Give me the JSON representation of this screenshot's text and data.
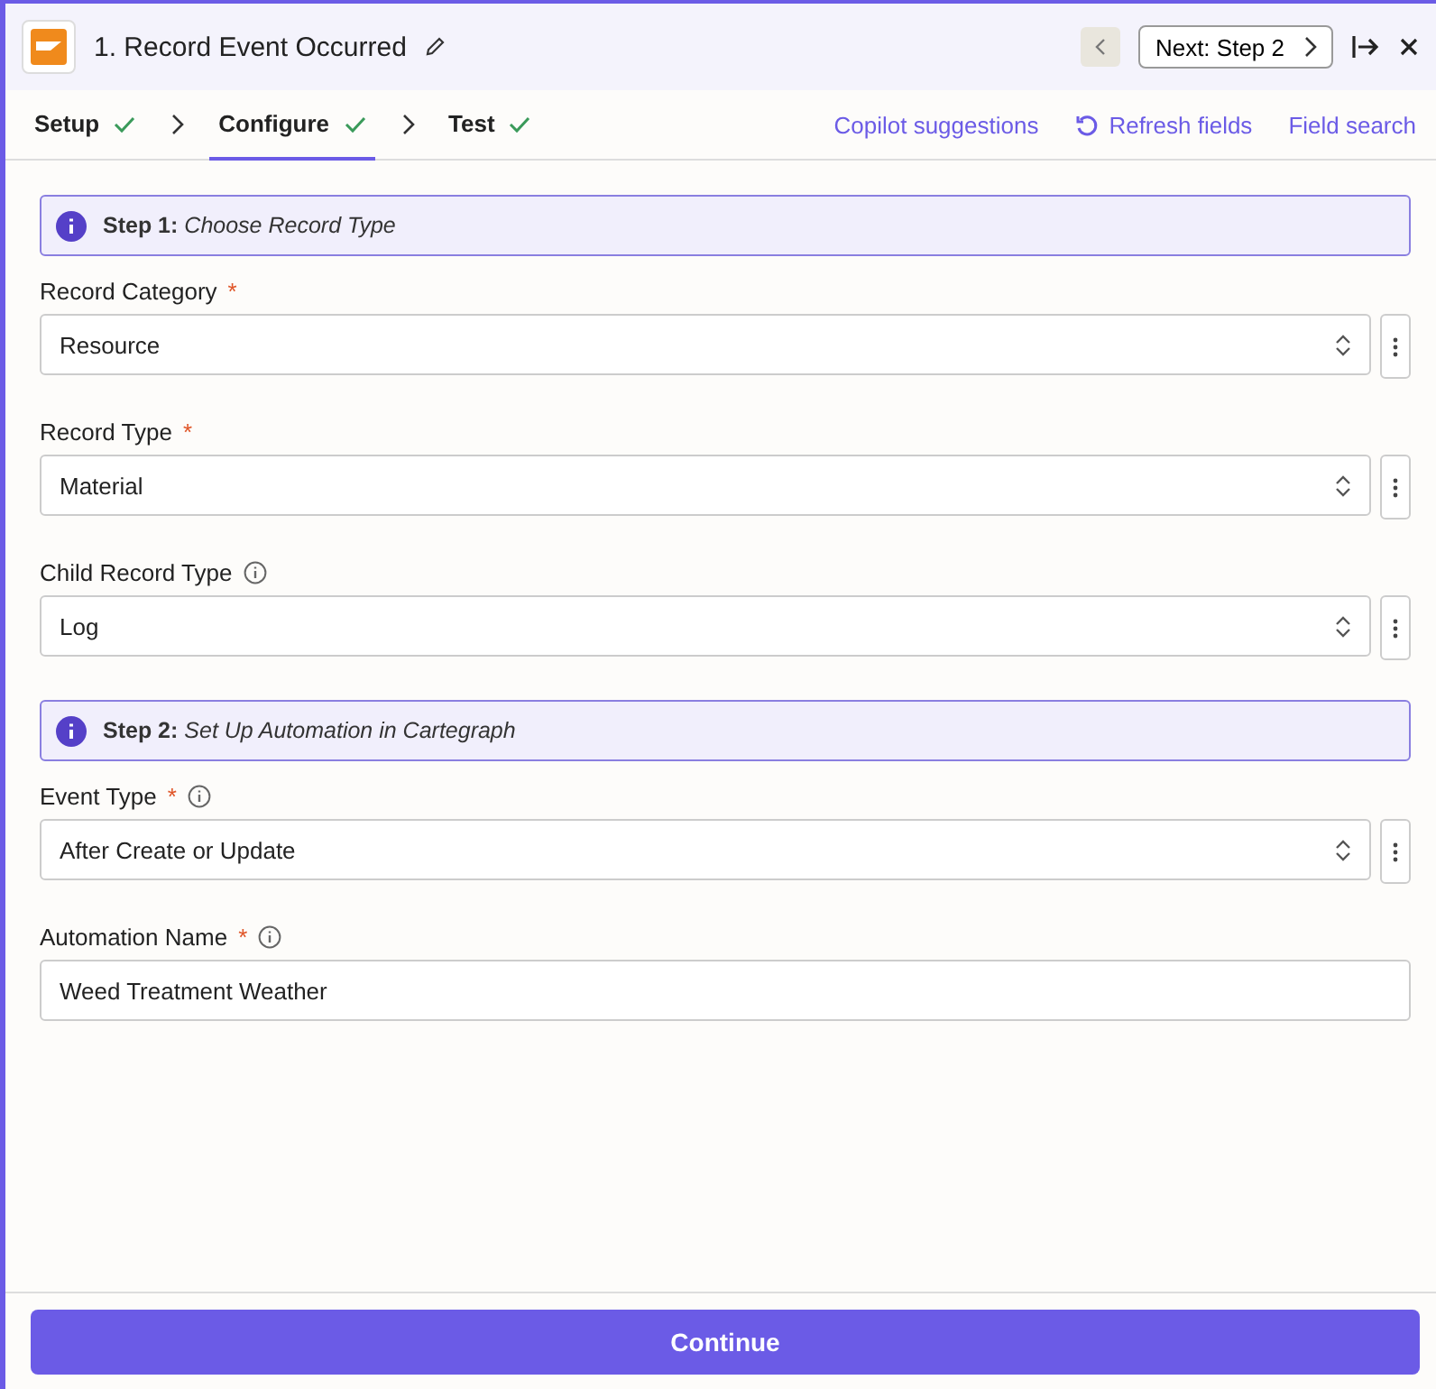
{
  "header": {
    "title": "1. Record Event Occurred",
    "next_button": "Next: Step 2"
  },
  "tabs": [
    {
      "label": "Setup",
      "done": true,
      "selected": false
    },
    {
      "label": "Configure",
      "done": true,
      "selected": true
    },
    {
      "label": "Test",
      "done": true,
      "selected": false
    }
  ],
  "actions": [
    {
      "label": "Copilot suggestions",
      "kind": "plain"
    },
    {
      "label": "Refresh fields",
      "kind": "refresh"
    },
    {
      "label": "Field search",
      "kind": "plain"
    }
  ],
  "form": [
    {
      "kind": "step",
      "text": "**Step 1:** *Choose Record Type*"
    },
    {
      "kind": "select",
      "label": "Record Category",
      "required_mark": "*",
      "info": false,
      "value": "Resource"
    },
    {
      "kind": "select",
      "label": "Record Type",
      "required_mark": "*",
      "info": false,
      "value": "Material"
    },
    {
      "kind": "select",
      "label": "Child Record Type",
      "info": true,
      "value": "Log"
    },
    {
      "kind": "step",
      "text": "**Step 2:** *Set Up Automation in Cartegraph*"
    },
    {
      "kind": "select",
      "label": "Event Type",
      "required_mark": "*",
      "info": true,
      "value": "After Create or Update"
    },
    {
      "kind": "text",
      "label": "Automation Name",
      "required_mark": "*",
      "info": true,
      "value": "Weed Treatment Weather"
    }
  ],
  "footer": {
    "button": "Continue"
  }
}
